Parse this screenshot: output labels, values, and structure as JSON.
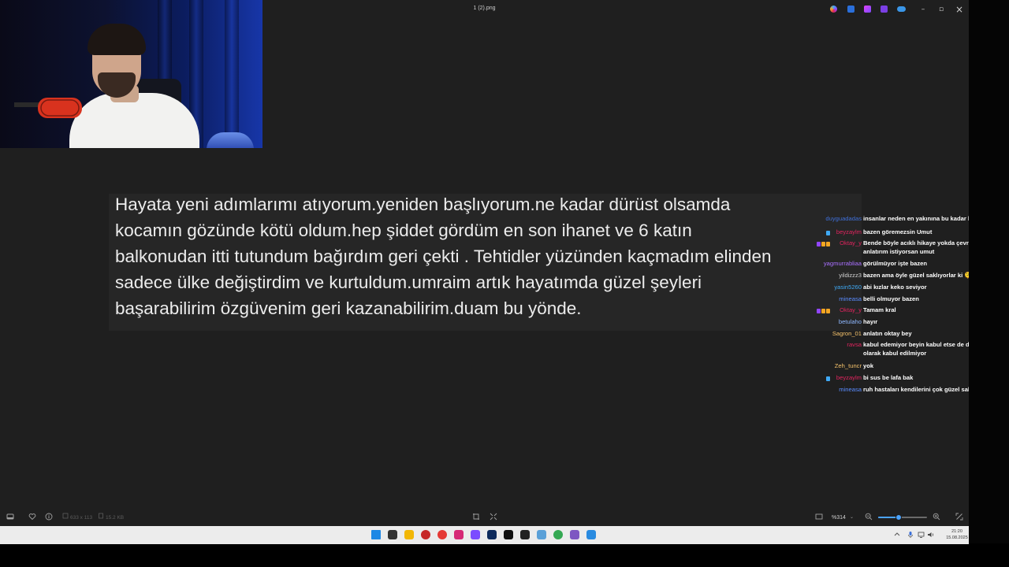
{
  "window": {
    "title": "1 (2).png",
    "controls": {
      "minimize": "–",
      "maximize": "▫",
      "close": "×"
    },
    "title_icons": [
      "copilot-icon",
      "edit-icon",
      "designer-icon",
      "clipchamp-icon",
      "onedrive-icon"
    ]
  },
  "photo": {
    "lines": [
      "Hayata yeni adımlarımı atıyorum.yeniden başlıyorum.ne kadar dürüst olsamda",
      "kocamın gözünde kötü oldum.hep şiddet gördüm en son ihanet ve 6 katın",
      "balkonudan itti tutundum bağırdım geri çekti . Tehtidler yüzünden kaçmadım elinden",
      "sadece ülke değiştirdim ve kurtuldum.umraim artık hayatımda güzel şeyleri",
      "başarabilirim özgüvenim geri kazanabilirim.duam bu yönde."
    ]
  },
  "chat": {
    "messages": [
      {
        "user": "duyguadadas",
        "color": "#3f6fd8",
        "badges": [],
        "text": "insanlar neden en yakınına bu kadar kötü olabiliyor"
      },
      {
        "user": "beyzaylm",
        "color": "#e0245e",
        "badges": [
          "#3fa9f5"
        ],
        "text": "bazen göremezsin Umut"
      },
      {
        "user": "Oktay_y",
        "color": "#e0245e",
        "badges": [
          "#9146ff",
          "#f5a623",
          "#f5a623"
        ],
        "text": "Bende böyle acıklı hikaye yokda çevremde çok var anlatırım istiyorsan umut"
      },
      {
        "user": "yagmurrabliaa",
        "color": "#a970ff",
        "badges": [],
        "text": "görülmüyor işte bazen"
      },
      {
        "user": "yildizzz3",
        "color": "#d0d0d0",
        "badges": [],
        "text": "bazen ama öyle güzel saklıyorlar ki 🫠"
      },
      {
        "user": "yasin5260",
        "color": "#3fa9f5",
        "badges": [],
        "text": "abi kızlar keko seviyor"
      },
      {
        "user": "mineasa",
        "color": "#5a8cff",
        "badges": [],
        "text": "belli olmuyor bazen"
      },
      {
        "user": "Oktay_y",
        "color": "#e0245e",
        "badges": [
          "#9146ff",
          "#f5a623",
          "#f5a623"
        ],
        "text": "Tamam kral"
      },
      {
        "user": "betulaho",
        "color": "#8fb8ff",
        "badges": [],
        "text": "hayır"
      },
      {
        "user": "Sagron_01",
        "color": "#f5c26b",
        "badges": [],
        "text": "anlatın oktay bey"
      },
      {
        "user": "ravsa",
        "color": "#e0245e",
        "badges": [],
        "text": "kabul edemiyor beyin kabul etse de duygusal olarak kabul edilmiyor"
      },
      {
        "user": "Zeh_tuncr",
        "color": "#f5c26b",
        "badges": [],
        "text": "yok"
      },
      {
        "user": "beyzaylm",
        "color": "#e0245e",
        "badges": [
          "#3fa9f5"
        ],
        "text": "bi sus be lafa bak"
      },
      {
        "user": "mineasa",
        "color": "#5a8cff",
        "badges": [],
        "text": "ruh hastaları kendilerini çok güzel saklıyor"
      }
    ]
  },
  "viewer_bottom": {
    "dimensions": "633 x 113",
    "file_size": "15.2 KB",
    "zoom_label": "%314",
    "zoom_level": 0.42
  },
  "taskbar": {
    "icons": [
      {
        "name": "start-icon",
        "color": "#1e88e5"
      },
      {
        "name": "task-view-icon",
        "color": "#333333"
      },
      {
        "name": "file-explorer-icon",
        "color": "#f2b705"
      },
      {
        "name": "app-icon-red",
        "color": "#c62828"
      },
      {
        "name": "opera-icon",
        "color": "#e53935"
      },
      {
        "name": "instagram-icon",
        "color": "#d62976"
      },
      {
        "name": "messenger-icon",
        "color": "#7b4cff"
      },
      {
        "name": "photoshop-icon",
        "color": "#0d2a5c"
      },
      {
        "name": "tiktok-icon",
        "color": "#111111"
      },
      {
        "name": "capcut-icon",
        "color": "#222222"
      },
      {
        "name": "settings-app-icon",
        "color": "#5aa0d8"
      },
      {
        "name": "chrome-icon",
        "color": "#34a853"
      },
      {
        "name": "app-icon-purple",
        "color": "#7e57c2"
      },
      {
        "name": "photos-app-icon",
        "color": "#2a8be0"
      }
    ],
    "time": "21:20",
    "date": "15.08.2025"
  }
}
